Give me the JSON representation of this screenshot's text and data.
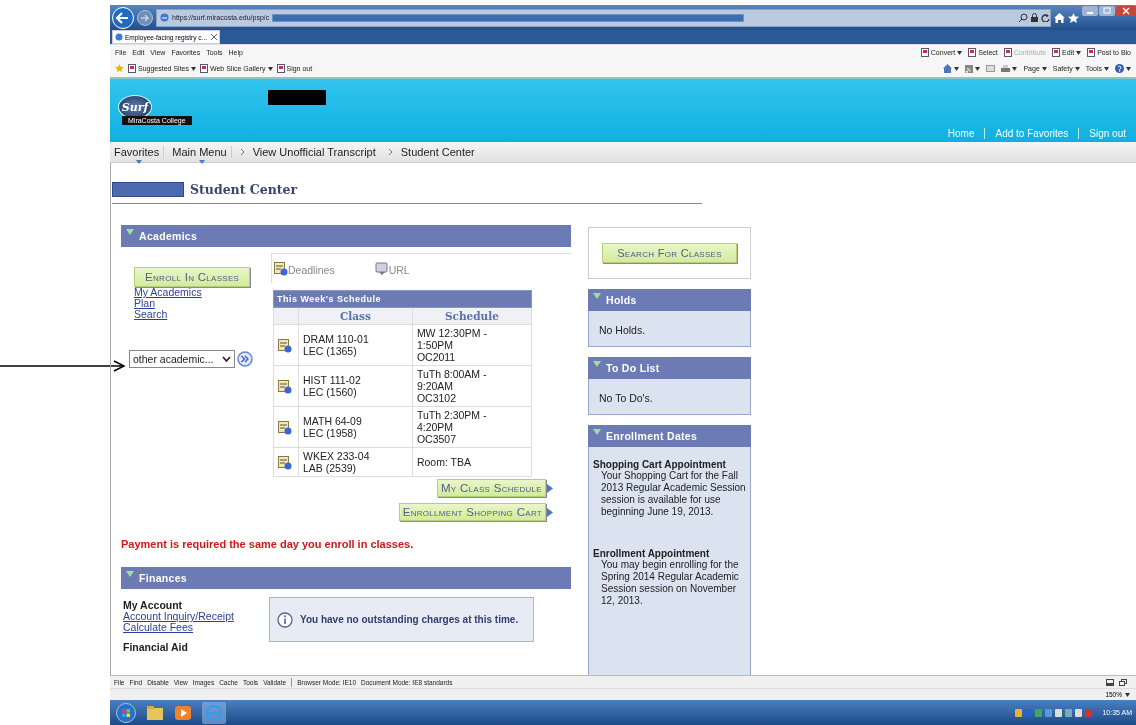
{
  "browser": {
    "address": "https://surf.miracosta.edu/psp/c",
    "tabs": [
      {
        "title": "Employee-facing registry c...",
        "selected": true
      }
    ],
    "menu": [
      "File",
      "Edit",
      "View",
      "Favorites",
      "Tools",
      "Help"
    ],
    "favorites": [
      {
        "label": "Suggested Sites",
        "dropdown": true
      },
      {
        "label": "Web Slice Gallery",
        "dropdown": true
      },
      {
        "label": "Sign out",
        "dropdown": false
      }
    ],
    "addons": [
      {
        "label": "Convert",
        "disabled": false,
        "dropdown": true
      },
      {
        "label": "Select",
        "disabled": false,
        "dropdown": false
      },
      {
        "label": "Contribute",
        "disabled": true,
        "dropdown": false
      },
      {
        "label": "Edit",
        "disabled": false,
        "dropdown": true
      },
      {
        "label": "Post to Blo",
        "disabled": false,
        "dropdown": false
      }
    ],
    "commands": [
      "Page",
      "Safety",
      "Tools"
    ]
  },
  "site": {
    "logo": "Surf",
    "college": "MiraCosta College",
    "links": [
      "Home",
      "Add to Favorites",
      "Sign out"
    ],
    "breadcrumb": [
      {
        "label": "Favorites",
        "menu": true
      },
      {
        "label": "Main Menu",
        "menu": true
      },
      {
        "label": "View Unofficial Transcript",
        "menu": false
      },
      {
        "label": "Student Center",
        "menu": false
      }
    ]
  },
  "page_title": "Student Center",
  "academics": {
    "title": "Academics",
    "enroll_button": "Enroll In Classes",
    "links": [
      "My Academics",
      "Plan",
      "Search"
    ],
    "select": {
      "value": "other academic..."
    },
    "deadlines": "Deadlines",
    "url": "URL",
    "schedule": {
      "title": "This Week's Schedule",
      "columns": [
        "Class",
        "Schedule"
      ],
      "rows": [
        {
          "class": "DRAM 110-01",
          "section": "LEC (1365)",
          "schedule": "MW 12:30PM -\n1:50PM\nOC2011"
        },
        {
          "class": "HIST 111-02",
          "section": "LEC (1560)",
          "schedule": "TuTh 8:00AM -\n9:20AM\nOC3102"
        },
        {
          "class": "MATH 64-09",
          "section": "LEC (1958)",
          "schedule": "TuTh 2:30PM -\n4:20PM\nOC3507"
        },
        {
          "class": "WKEX 233-04",
          "section": "LAB (2539)",
          "schedule": "Room:  TBA"
        }
      ]
    },
    "buttons": [
      "My Class Schedule",
      "Enrollment Shopping Cart"
    ]
  },
  "payment_notice": "Payment is required the same day you enroll in classes.",
  "finances": {
    "title": "Finances",
    "my_account": {
      "heading": "My Account",
      "links": [
        "Account Inquiry/Receipt",
        "Calculate Fees"
      ]
    },
    "financial_aid": "Financial Aid",
    "notice": "You have no outstanding charges at this time."
  },
  "search_button": "Search For Classes",
  "holds": {
    "title": "Holds",
    "text": "No Holds."
  },
  "todo": {
    "title": "To Do List",
    "text": "No To Do's."
  },
  "enrollment_dates": {
    "title": "Enrollment Dates",
    "items": [
      {
        "heading": "Shopping Cart Appointment",
        "text": "Your Shopping Cart for the Fall 2013 Regular Academic Session session is available for use beginning June 19, 2013."
      },
      {
        "heading": "Enrollment Appointment",
        "text": "You may begin enrolling for the Spring 2014 Regular Academic Session session on November 12, 2013."
      }
    ]
  },
  "devtools": {
    "menu": [
      "File",
      "Find",
      "Disable",
      "View",
      "Images",
      "Cache",
      "Tools",
      "Validate"
    ],
    "browser_mode": "Browser Mode: IE10",
    "document_mode": "Document Mode: IE8 standards"
  },
  "zoom": "150%",
  "clock": "10:35 AM"
}
